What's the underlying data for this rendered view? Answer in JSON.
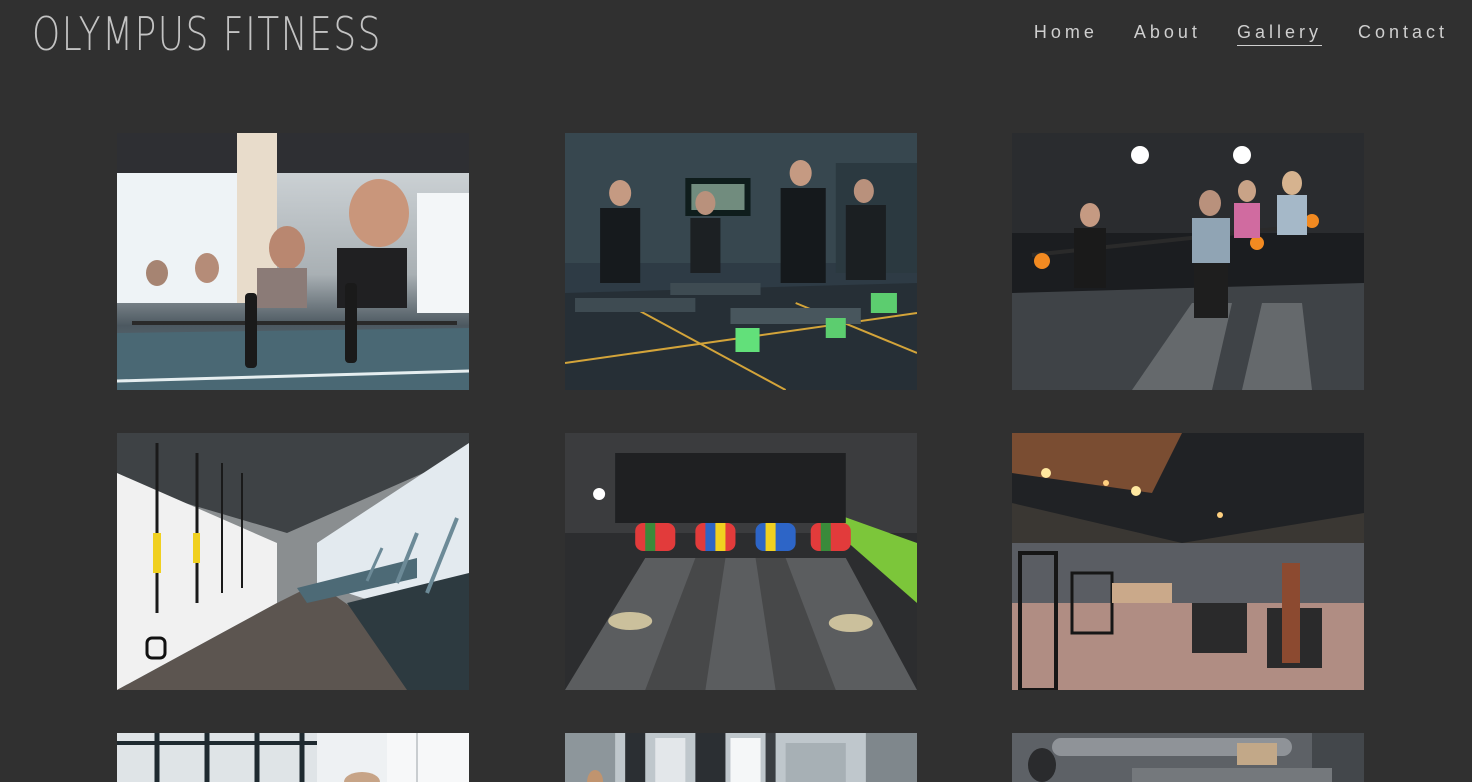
{
  "brand": {
    "name": "OLYMPUS FITNESS"
  },
  "nav": {
    "items": [
      {
        "label": "Home",
        "active": false
      },
      {
        "label": "About",
        "active": false
      },
      {
        "label": "Gallery",
        "active": true
      },
      {
        "label": "Contact",
        "active": false
      }
    ]
  },
  "gallery": {
    "images": [
      {
        "subject": "deadlift-group"
      },
      {
        "subject": "step-class"
      },
      {
        "subject": "barbell-lunge-class"
      },
      {
        "subject": "trx-and-treadmills"
      },
      {
        "subject": "plate-rack-and-mats"
      },
      {
        "subject": "gym-floor-overview"
      },
      {
        "subject": "window-studio"
      },
      {
        "subject": "city-view-studio"
      },
      {
        "subject": "ducted-ceiling-gym"
      }
    ]
  },
  "colors": {
    "background": "#303030",
    "brand_text": "#c3c3c3",
    "nav_text": "#cfcfcf"
  }
}
